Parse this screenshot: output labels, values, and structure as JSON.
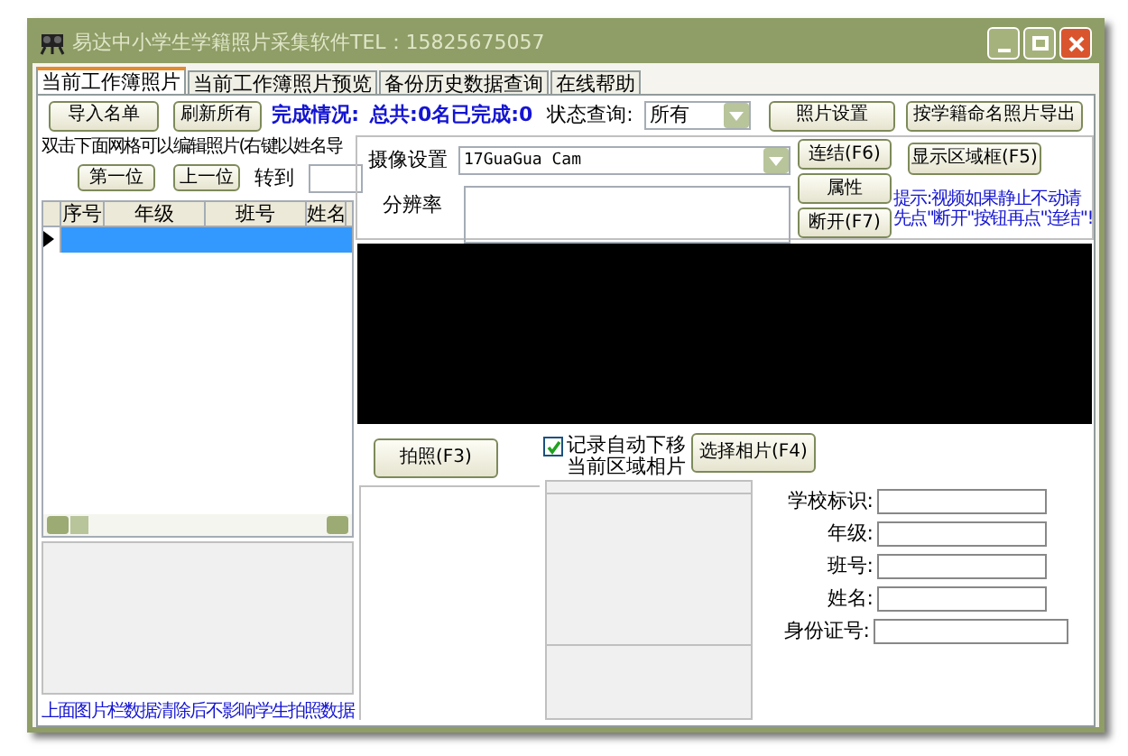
{
  "window": {
    "title": "易达中小学生学籍照片采集软件TEL：15825675057"
  },
  "tabs": [
    {
      "label": "当前工作簿照片",
      "selected": true
    },
    {
      "label": "当前工作簿照片预览",
      "selected": false
    },
    {
      "label": "备份历史数据查询",
      "selected": false
    },
    {
      "label": "在线帮助",
      "selected": false
    }
  ],
  "toolbar": {
    "import_button": "导入名单",
    "refresh_button": "刷新所有",
    "progress_label": "完成情况:",
    "progress_value": "总共:0名已完成:0",
    "status_label": "状态查询:",
    "status_value": "所有",
    "photo_settings_button": "照片设置",
    "export_button": "按学籍命名照片导出"
  },
  "left": {
    "hint": "双击下面网格可以编辑照片(右键以姓名导",
    "first_button": "第一位",
    "prev_button": "上一位",
    "goto_label": "转到",
    "table": {
      "columns": [
        "序号",
        "年级",
        "班号",
        "姓名"
      ],
      "rows": [
        {
          "selected": true
        }
      ]
    },
    "footer": "上面图片栏数据清除后不影响学生拍照数据"
  },
  "camera": {
    "device_label": "摄像设置",
    "device_value": "17GuaGua Cam",
    "resolution_label": "分辨率",
    "connect_button": "连结(F6)",
    "properties_button": "属性",
    "disconnect_button": "断开(F7)",
    "show_frame_button": "显示区域框(F5)",
    "tip_lines": [
      "提示:视频如果静止不动请",
      "先点\"断开\"按钮再点\"连结\"!"
    ]
  },
  "capture": {
    "shoot_button": "拍照(F3)",
    "auto_move": {
      "label_lines": [
        "记录自动下移",
        "当前区域相片"
      ],
      "checked": true
    },
    "choose_button": "选择相片(F4)"
  },
  "form": [
    {
      "label": "学校标识:"
    },
    {
      "label": "年级:"
    },
    {
      "label": "班号:"
    },
    {
      "label": "姓名:"
    },
    {
      "label": "身份证号:"
    }
  ]
}
